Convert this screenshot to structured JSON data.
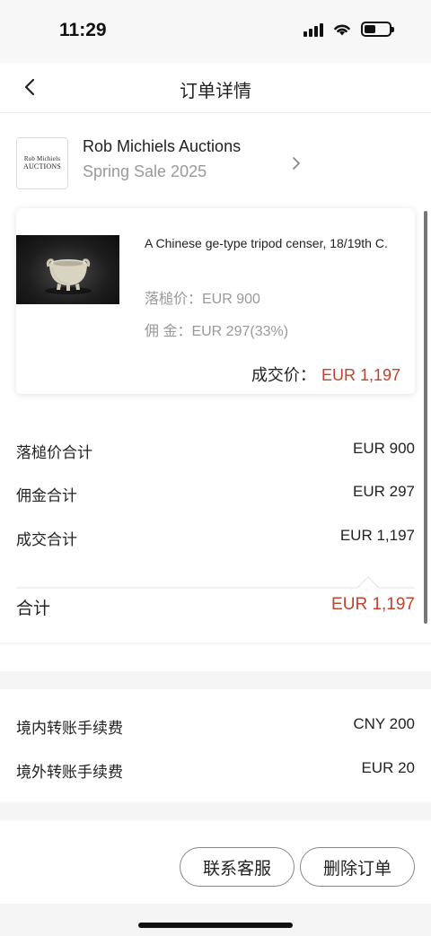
{
  "status_bar": {
    "time": "11:29"
  },
  "nav": {
    "title": "订单详情"
  },
  "seller": {
    "logo_line1": "Rob Michiels",
    "logo_line2": "AUCTIONS",
    "name": "Rob Michiels Auctions",
    "sale": "Spring Sale 2025"
  },
  "lot": {
    "title": "A Chinese ge-type tripod censer, 18/19th C.",
    "hammer": "落槌价：EUR 900",
    "premium": "佣 金：EUR 297(33%)",
    "deal_label": "成交价：",
    "deal_value": "EUR 1,197"
  },
  "summary": {
    "rows": [
      {
        "label": "落槌价合计",
        "value": "EUR 900"
      },
      {
        "label": "佣金合计",
        "value": "EUR 297"
      },
      {
        "label": "成交合计",
        "value": "EUR 1,197"
      }
    ],
    "total_label": "合计",
    "total_value": "EUR 1,197"
  },
  "fees": {
    "rows": [
      {
        "label": "境内转账手续费",
        "value": "CNY 200"
      },
      {
        "label": "境外转账手续费",
        "value": "EUR 20"
      }
    ]
  },
  "actions": {
    "contact_label": "联系客服",
    "delete_label": "删除订单"
  },
  "colors": {
    "accent_red": "#c0432e",
    "muted_gray": "#999999"
  },
  "icons": [
    "back-chevron-icon",
    "chevron-right-icon",
    "signal-icon",
    "wifi-icon",
    "battery-icon"
  ]
}
